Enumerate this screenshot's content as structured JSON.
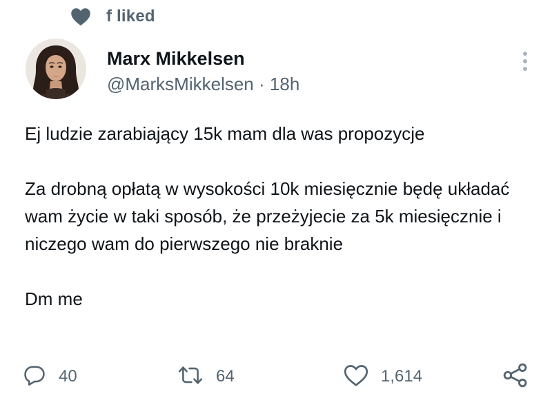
{
  "social_context": {
    "text": "f liked",
    "icon": "heart-icon"
  },
  "tweet": {
    "author": {
      "display_name": "Marx Mikkelsen",
      "handle": "@MarksMikkelsen",
      "separator": "·",
      "time_ago": "18h"
    },
    "paragraphs": [
      "Ej ludzie zarabiający 15k mam dla was propozycje",
      "Za drobną opłatą w wysokości 10k miesięcznie będę układać wam życie w taki sposób, że przeżyjecie za 5k miesięcznie i niczego wam do pierwszego nie braknie",
      "Dm me"
    ],
    "actions": {
      "replies": "40",
      "retweets": "64",
      "likes": "1,614"
    }
  },
  "colors": {
    "text_primary": "#0f1419",
    "text_secondary": "#536471",
    "icon": "#536471",
    "liked_heart": "#536471"
  }
}
